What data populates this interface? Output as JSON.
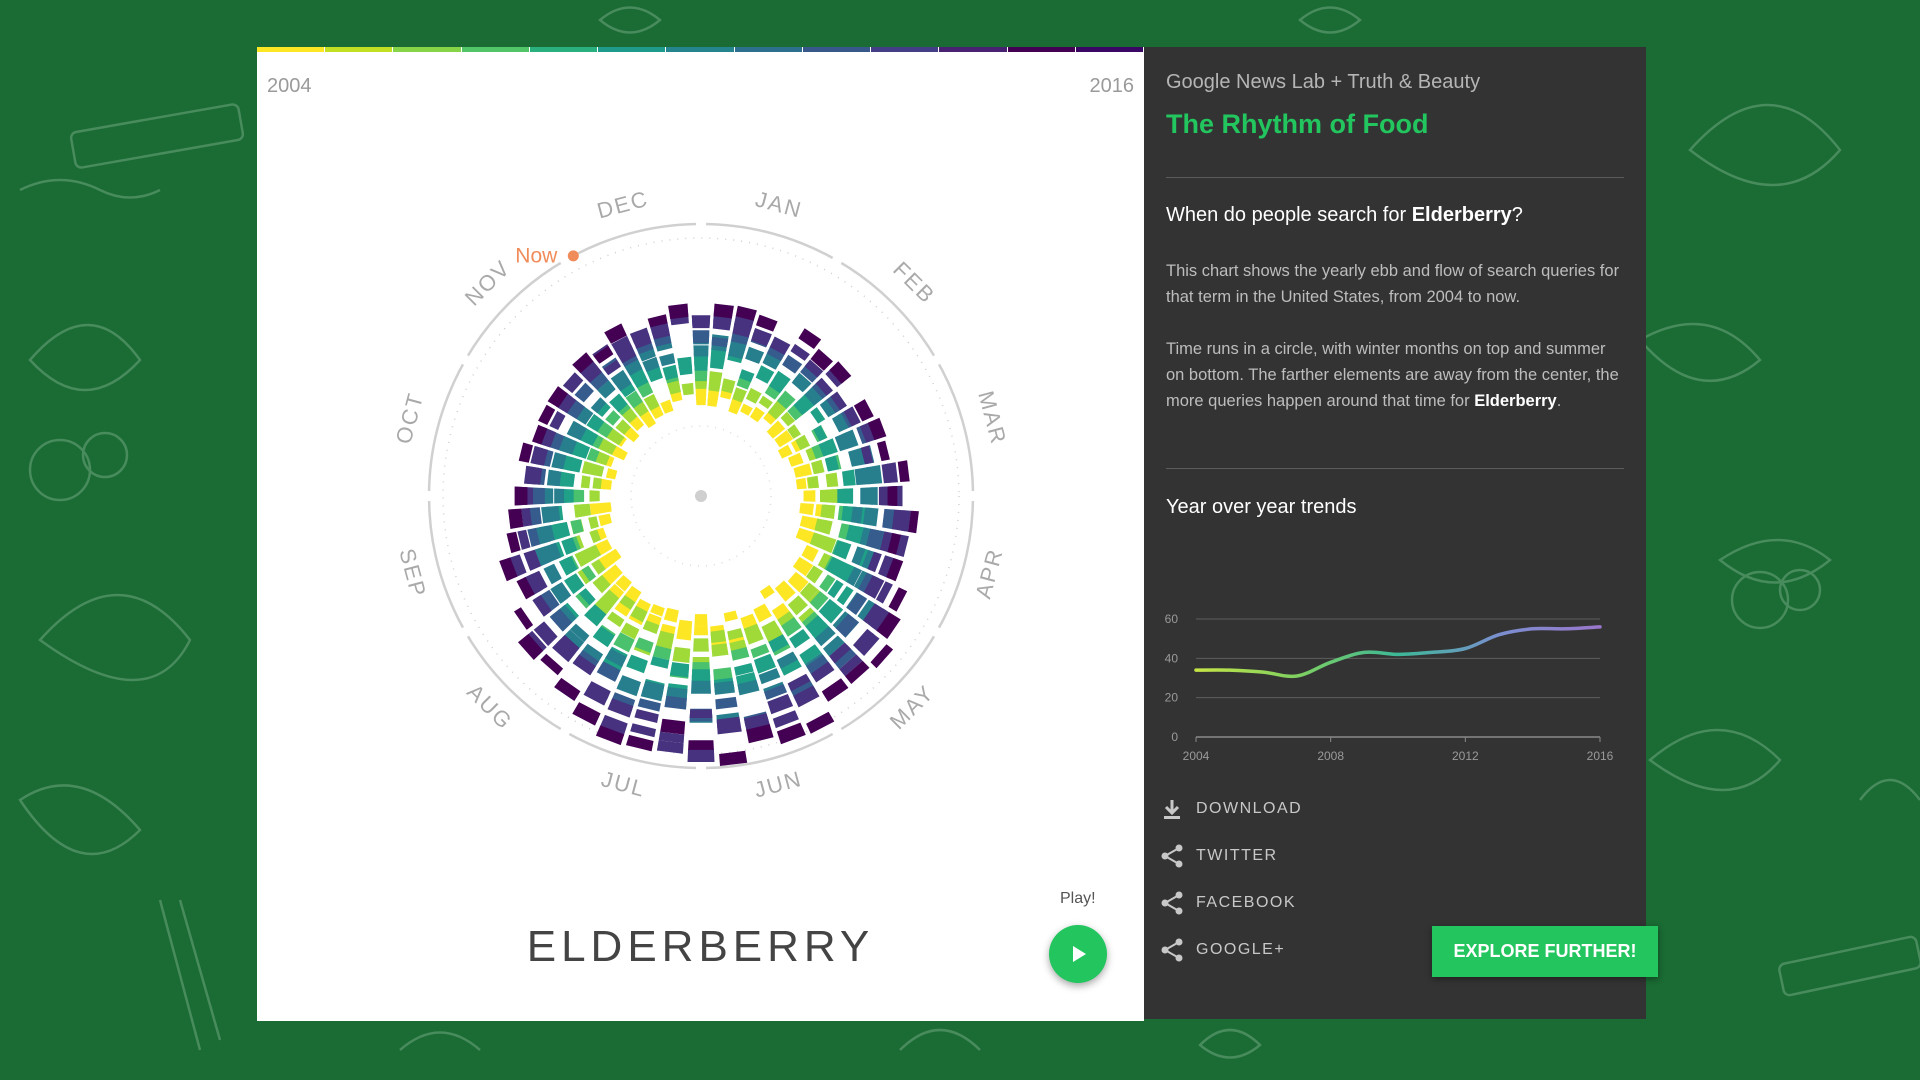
{
  "timeline": {
    "start_year": "2004",
    "end_year": "2016",
    "segment_colors": [
      "#fde725",
      "#c2df23",
      "#86d549",
      "#52c569",
      "#2ab07f",
      "#1e9b8a",
      "#25858e",
      "#2d708e",
      "#38588c",
      "#433e85",
      "#482173",
      "#440154",
      "#3b0764"
    ]
  },
  "radial_chart": {
    "months": [
      "JAN",
      "FEB",
      "MAR",
      "APR",
      "MAY",
      "JUN",
      "JUL",
      "AUG",
      "SEP",
      "OCT",
      "NOV",
      "DEC"
    ],
    "now_label": "Now",
    "now_color": "#f08c5a",
    "palette": [
      "#fde725",
      "#a0da39",
      "#4ac16d",
      "#1fa187",
      "#277f8e",
      "#365c8d",
      "#46327e",
      "#440154"
    ]
  },
  "term": "ELDERBERRY",
  "play_label": "Play!",
  "sidebar": {
    "credit": "Google News Lab + Truth & Beauty",
    "app_title": "The Rhythm of Food",
    "question_prefix": "When do people search for ",
    "question_term": "Elderberry",
    "question_suffix": "?",
    "paragraph1": "This chart shows the yearly ebb and flow of search queries for that term in the United States, from 2004 to now.",
    "paragraph2_text": "Time runs in a circle, with winter months on top and summer on bottom. The farther elements are away from the center, the more queries happen around that time for ",
    "paragraph2_term": "Elderberry",
    "paragraph2_end": ".",
    "trends_title": "Year over year trends",
    "actions": [
      {
        "label": "DOWNLOAD",
        "icon": "download-icon"
      },
      {
        "label": "TWITTER",
        "icon": "share-icon"
      },
      {
        "label": "FACEBOOK",
        "icon": "share-icon"
      },
      {
        "label": "GOOGLE+",
        "icon": "share-icon"
      }
    ],
    "explore_label": "EXPLORE FURTHER!"
  },
  "colors": {
    "accent": "#22c55e",
    "background": "#1a6b34",
    "panel": "#333333"
  },
  "chart_data": {
    "type": "line",
    "title": "Year over year trends",
    "xlabel": "",
    "ylabel": "",
    "x": [
      2004,
      2005,
      2006,
      2007,
      2008,
      2009,
      2010,
      2011,
      2012,
      2013,
      2014,
      2015,
      2016
    ],
    "values": [
      34,
      34,
      33,
      31,
      38,
      43,
      42,
      43,
      45,
      52,
      55,
      55,
      56
    ],
    "xlim": [
      2004,
      2016
    ],
    "ylim": [
      0,
      60
    ],
    "x_ticks": [
      2004,
      2008,
      2012,
      2016
    ],
    "y_ticks": [
      0,
      20,
      40,
      60
    ],
    "gradient": [
      "#c5e547",
      "#7fd060",
      "#3cb897",
      "#7a8fd0",
      "#9a76cc"
    ],
    "grid": true
  }
}
